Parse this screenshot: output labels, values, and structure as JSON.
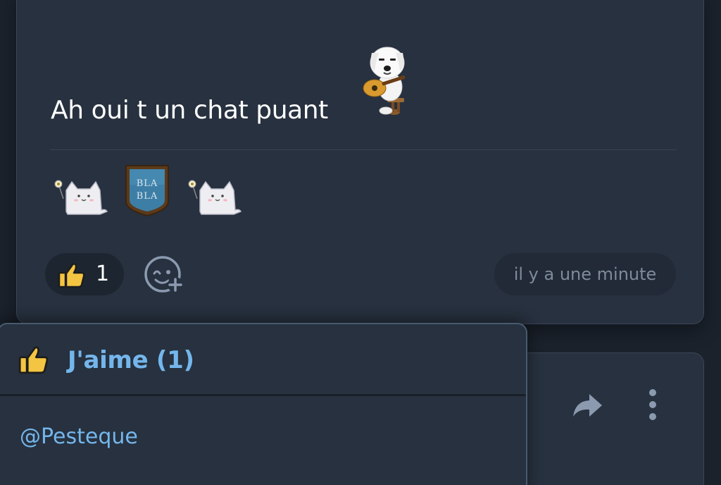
{
  "post": {
    "text": "Ah oui t un chat puant",
    "stickers": {
      "main": "guitar-dog-sticker",
      "row": [
        "flower-cat-emoji",
        "blabla-emoji",
        "flower-cat-emoji"
      ],
      "blabla_text": "BLA BLA"
    },
    "reaction": {
      "icon": "thumbs-up-icon",
      "count": "1"
    },
    "add_reaction_icon": "add-reaction-icon",
    "timestamp": "il y a une minute"
  },
  "next_post": {
    "share_icon": "share-icon",
    "more_icon": "more-vertical-icon"
  },
  "reactions_popup": {
    "icon": "thumbs-up-icon",
    "title": "J'aime (1)",
    "users": [
      "@Pesteque"
    ]
  },
  "colors": {
    "page_bg": "#1b222c",
    "card_bg": "#27313f",
    "accent_blue": "#74b6ec",
    "muted_text": "#7e8b9d",
    "thumb_yellow": "#f4c542"
  }
}
